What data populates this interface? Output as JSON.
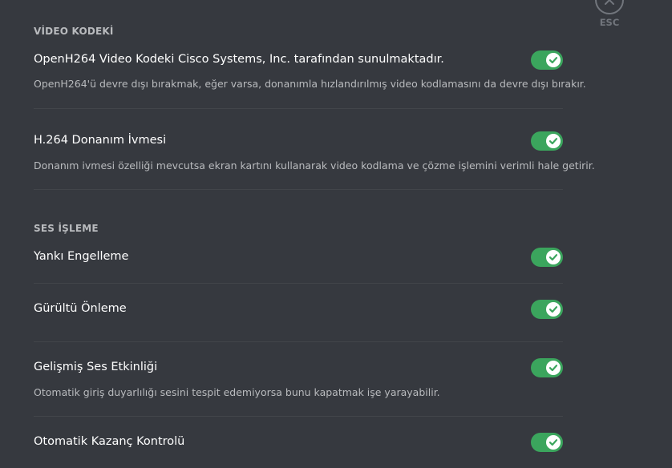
{
  "close": {
    "label": "ESC"
  },
  "sections": {
    "video_codec": {
      "header": "VİDEO KODEKİ",
      "rows": [
        {
          "title": "OpenH264 Video Kodeki Cisco Systems, Inc. tarafından sunulmaktadır.",
          "description": "OpenH264'ü devre dışı bırakmak, eğer varsa, donanımla hızlandırılmış video kodlamasını da devre dışı bırakır.",
          "enabled": true
        },
        {
          "title": "H.264 Donanım İvmesi",
          "description": "Donanım ivmesi özelliği mevcutsa ekran kartını kullanarak video kodlama ve çözme işlemini verimli hale getirir.",
          "enabled": true
        }
      ]
    },
    "audio_processing": {
      "header": "SES İŞLEME",
      "rows": [
        {
          "title": "Yankı Engelleme",
          "enabled": true
        },
        {
          "title": "Gürültü Önleme",
          "enabled": true
        },
        {
          "title": "Gelişmiş Ses Etkinliği",
          "description": "Otomatik giriş duyarlılığı sesini tespit edemiyorsa bunu kapatmak işe yarayabilir.",
          "enabled": true
        },
        {
          "title": "Otomatik Kazanç Kontrolü",
          "enabled": true
        }
      ]
    }
  },
  "colors": {
    "background": "#36393f",
    "toggle_on": "#3ba55d",
    "header_text": "#b9bbbe",
    "title_text": "#ffffff",
    "divider": "#42454a",
    "esc": "#72767d"
  },
  "icons": {
    "toggle_knob": "checkmark-icon",
    "close": "close-icon"
  }
}
